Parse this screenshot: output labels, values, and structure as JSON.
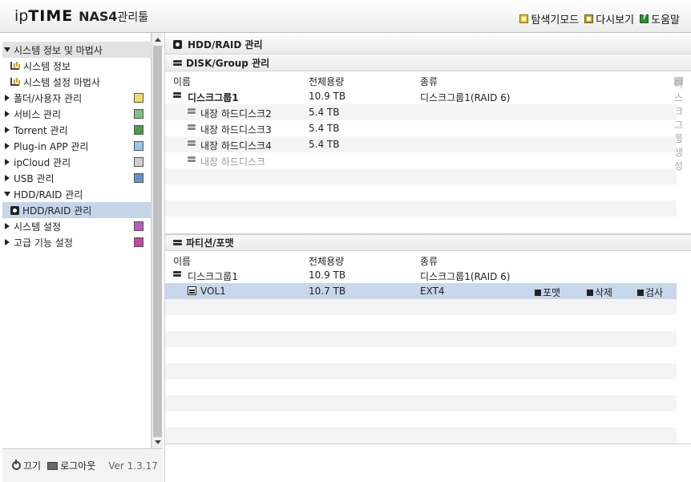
{
  "header": {
    "logo_ip": "ip",
    "logo_time": "TIME",
    "logo_nas": "NAS4",
    "logo_mgr": "관리툴",
    "links": [
      "탐색기모드",
      "다시보기",
      "도움말"
    ]
  },
  "sidebar": {
    "items": [
      {
        "label": "시스템 정보 및 마법사",
        "type": "group-open"
      },
      {
        "label": "시스템 정보",
        "type": "sub"
      },
      {
        "label": "시스템 설정 마법사",
        "type": "sub"
      },
      {
        "label": "폴더/사용자 관리",
        "type": "group"
      },
      {
        "label": "서비스 관리",
        "type": "group"
      },
      {
        "label": "Torrent 관리",
        "type": "group"
      },
      {
        "label": "Plug-in APP 관리",
        "type": "group"
      },
      {
        "label": "ipCloud 관리",
        "type": "group"
      },
      {
        "label": "USB 관리",
        "type": "group"
      },
      {
        "label": "HDD/RAID 관리",
        "type": "group-open-plain"
      },
      {
        "label": "HDD/RAID 관리",
        "type": "selected"
      },
      {
        "label": "시스템 설정",
        "type": "group"
      },
      {
        "label": "고급 기능 설정",
        "type": "group"
      }
    ],
    "footer": {
      "power": "끄기",
      "logout": "로그아웃",
      "version": "Ver 1.3.17"
    }
  },
  "main": {
    "title": "HDD/RAID 관리",
    "disk_section": {
      "title": "DISK/Group 관리",
      "columns": [
        "이름",
        "전체용량",
        "종류"
      ],
      "create_label": "디스크그룹 생성",
      "rows": [
        {
          "name": "디스크그룹1",
          "capacity": "10.9 TB",
          "kind": "디스크그룹1(RAID 6)"
        },
        {
          "name": "내장 하드디스크2",
          "capacity": "5.4 TB",
          "kind": ""
        },
        {
          "name": "내장 하드디스크3",
          "capacity": "5.4 TB",
          "kind": ""
        },
        {
          "name": "내장 하드디스크4",
          "capacity": "5.4 TB",
          "kind": ""
        },
        {
          "name": "내장 하드디스크",
          "capacity": "",
          "kind": ""
        }
      ]
    },
    "partition_section": {
      "title": "파티션/포맷",
      "columns": [
        "이름",
        "전체용량",
        "종류"
      ],
      "rows": [
        {
          "name": "디스크그룹1",
          "capacity": "10.9 TB",
          "kind": "디스크그룹1(RAID 6)"
        },
        {
          "name": "VOL1",
          "capacity": "10.7 TB",
          "kind": "EXT4"
        }
      ],
      "actions": [
        "포맷",
        "삭제",
        "검사"
      ]
    }
  }
}
